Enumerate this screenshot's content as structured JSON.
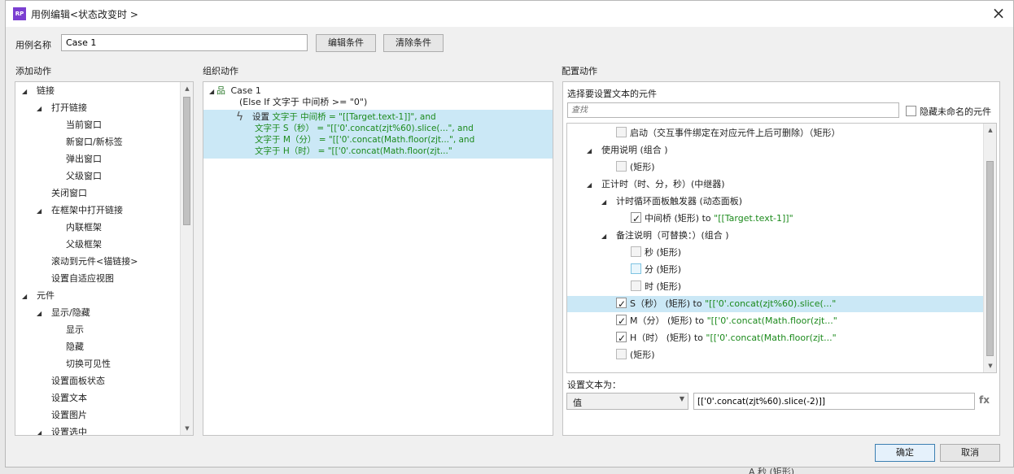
{
  "window": {
    "title": "用例编辑<状态改变时 >",
    "icon_label": "RP"
  },
  "case": {
    "label": "用例名称",
    "value": "Case 1"
  },
  "buttons": {
    "edit": "编辑条件",
    "clear": "清除条件",
    "ok": "确定",
    "cancel": "取消"
  },
  "sections": {
    "add": "添加动作",
    "organize": "组织动作",
    "config": "配置动作"
  },
  "add_tree": [
    {
      "label": "链接",
      "level": 0,
      "expand": true
    },
    {
      "label": "打开链接",
      "level": 1,
      "expand": true
    },
    {
      "label": "当前窗口",
      "level": 2
    },
    {
      "label": "新窗口/新标签",
      "level": 2
    },
    {
      "label": "弹出窗口",
      "level": 2
    },
    {
      "label": "父级窗口",
      "level": 2
    },
    {
      "label": "关闭窗口",
      "level": 1
    },
    {
      "label": "在框架中打开链接",
      "level": 1,
      "expand": true
    },
    {
      "label": "内联框架",
      "level": 2
    },
    {
      "label": "父级框架",
      "level": 2
    },
    {
      "label": "滚动到元件<锚链接>",
      "level": 1
    },
    {
      "label": "设置自适应视图",
      "level": 1
    },
    {
      "label": "元件",
      "level": 0,
      "expand": true
    },
    {
      "label": "显示/隐藏",
      "level": 1,
      "expand": true
    },
    {
      "label": "显示",
      "level": 2
    },
    {
      "label": "隐藏",
      "level": 2
    },
    {
      "label": "切换可见性",
      "level": 2
    },
    {
      "label": "设置面板状态",
      "level": 1
    },
    {
      "label": "设置文本",
      "level": 1
    },
    {
      "label": "设置图片",
      "level": 1
    },
    {
      "label": "设置选中",
      "level": 1,
      "expand": true
    }
  ],
  "organize": {
    "case_name": "Case 1",
    "condition": "(Else If 文字于 中间桥 >= \"0\")",
    "action_prefix": "设置 ",
    "action_lines": [
      "文字于 中间桥 = \"[[Target.text-1]]\", and",
      "文字于 S（秒） = \"[['0'.concat(zjt%60).slice(...\", and",
      "文字于 M（分） = \"[['0'.concat(Math.floor(zjt...\", and",
      "文字于 H（时） = \"[['0'.concat(Math.floor(zjt...\""
    ]
  },
  "config": {
    "select_label": "选择要设置文本的元件",
    "search_placeholder": "查找",
    "hide_unnamed": "隐藏未命名的元件",
    "tree": [
      {
        "level": 1,
        "check": "dim",
        "label": "启动（交互事件绑定在对应元件上后可删除）（矩形）"
      },
      {
        "level": 0,
        "expand": true,
        "label": "使用说明 (组合 )"
      },
      {
        "level": 1,
        "check": "dim",
        "label": "(矩形)"
      },
      {
        "level": 0,
        "expand": true,
        "label": "正计时（时、分，秒）(中继器)"
      },
      {
        "level": 1,
        "expand": true,
        "label": "计时循环面板触发器 (动态面板)"
      },
      {
        "level": 2,
        "check": "on",
        "label": "中间桥 (矩形)",
        "to": " to ",
        "value": "\"[[Target.text-1]]\""
      },
      {
        "level": 1,
        "expand": true,
        "label": "备注说明（可替换：）(组合 )"
      },
      {
        "level": 2,
        "check": "dim",
        "label": "秒 (矩形)"
      },
      {
        "level": 2,
        "check": "hl",
        "label": "分 (矩形)"
      },
      {
        "level": 2,
        "check": "dim",
        "label": "时 (矩形)"
      },
      {
        "level": 1,
        "check": "on",
        "label": "S（秒） (矩形)",
        "to": " to ",
        "value": "\"[['0'.concat(zjt%60).slice(...\"",
        "selected": true
      },
      {
        "level": 1,
        "check": "on",
        "label": "M（分） (矩形)",
        "to": " to ",
        "value": "\"[['0'.concat(Math.floor(zjt...\""
      },
      {
        "level": 1,
        "check": "on",
        "label": "H（时） (矩形)",
        "to": " to ",
        "value": "\"[['0'.concat(Math.floor(zjt...\""
      },
      {
        "level": 1,
        "check": "dim",
        "label": "(矩形)"
      }
    ],
    "set_text_label": "设置文本为：",
    "type_value": "值",
    "text_value": "[['0'.concat(zjt%60).slice(-2)]]",
    "fx_label": "fx"
  },
  "background": {
    "tooltip_char": "分",
    "bottom_text": "A 秒 (矩形)"
  }
}
